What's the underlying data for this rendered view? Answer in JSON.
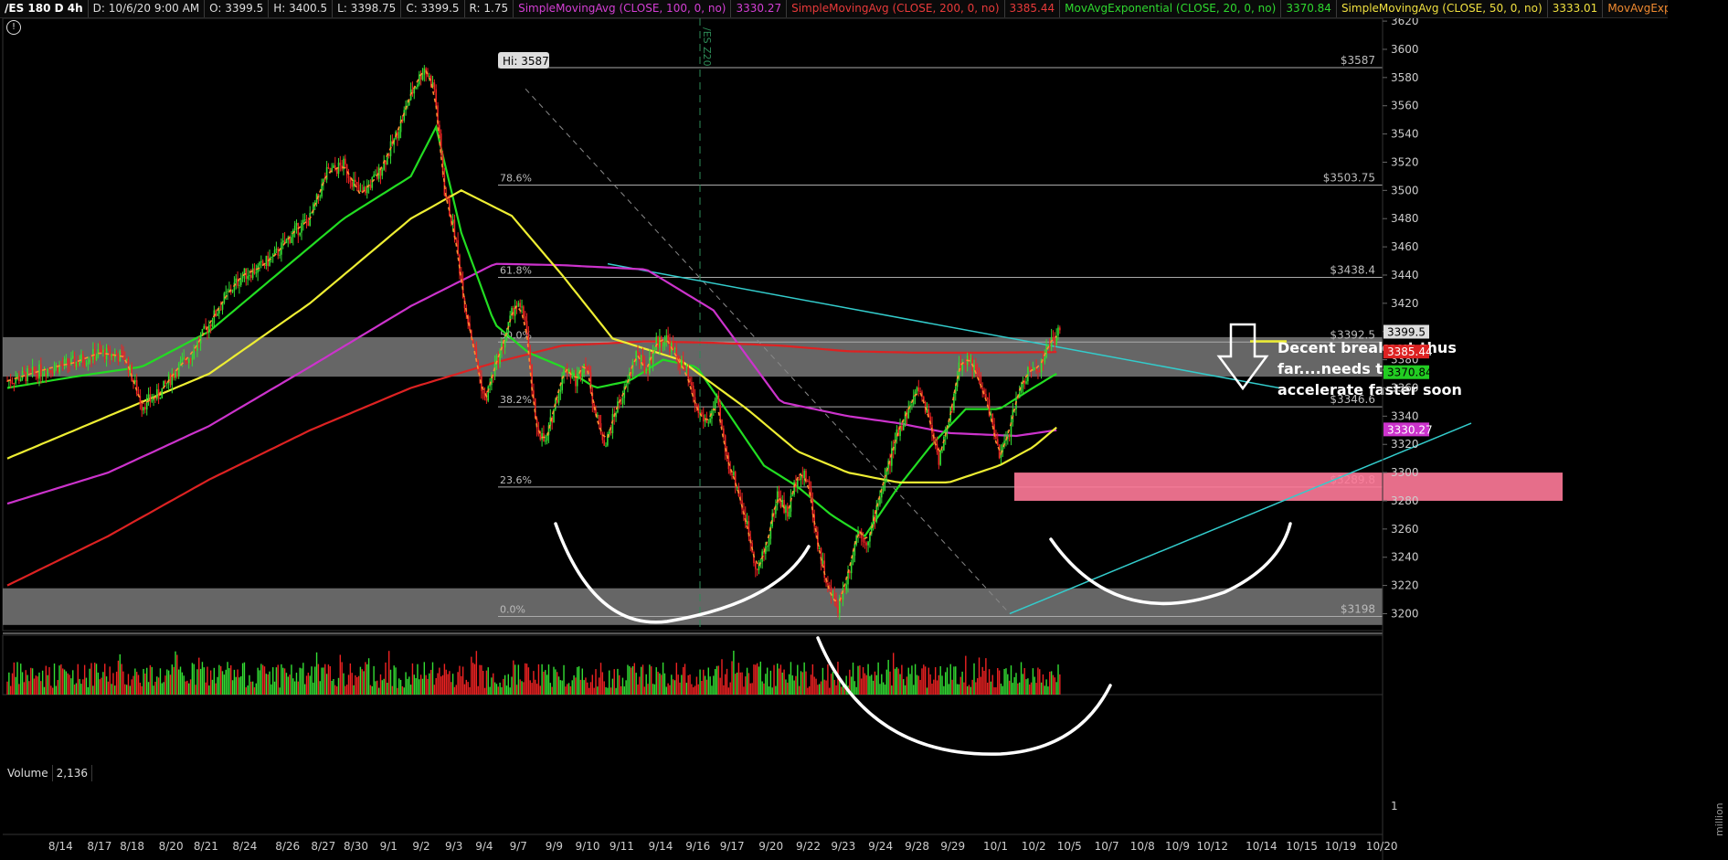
{
  "header": {
    "symbol": "/ES 180 D 4h",
    "items": [
      {
        "text": "D: 10/6/20 9:00 AM",
        "color": "#dddddd"
      },
      {
        "text": "O: 3399.5",
        "color": "#dddddd"
      },
      {
        "text": "H: 3400.5",
        "color": "#dddddd"
      },
      {
        "text": "L: 3398.75",
        "color": "#dddddd"
      },
      {
        "text": "C: 3399.5",
        "color": "#dddddd"
      },
      {
        "text": "R: 1.75",
        "color": "#dddddd"
      },
      {
        "text": "SimpleMovingAvg (CLOSE, 100, 0, no)",
        "color": "#d43fd4"
      },
      {
        "text": "3330.27",
        "color": "#d43fd4"
      },
      {
        "text": "SimpleMovingAvg (CLOSE, 200, 0, no)",
        "color": "#e83a3a"
      },
      {
        "text": "3385.44",
        "color": "#e83a3a"
      },
      {
        "text": "MovAvgExponential (CLOSE, 20, 0, no)",
        "color": "#2fd82f"
      },
      {
        "text": "3370.84",
        "color": "#2fd82f"
      },
      {
        "text": "SimpleMovingAvg (CLOSE, 50, 0, no)",
        "color": "#f0e040"
      },
      {
        "text": "3333.01",
        "color": "#f0e040"
      },
      {
        "text": "MovAvgExponential (CLOSE...",
        "color": "#f08a30"
      }
    ]
  },
  "volume_panel": {
    "label": "Volume",
    "value": "2,136",
    "ticks": [
      "1"
    ],
    "unit_label": "million"
  },
  "annotation": {
    "lines": [
      "Decent breakout thus",
      "far....needs to",
      "accelerate faster soon"
    ],
    "hi_label": "Hi: 3587",
    "vline_label": "/ES Z20"
  },
  "colors": {
    "up": "#33dd33",
    "down": "#ee2222",
    "sma100": "#cc33cc",
    "sma200": "#dd2222",
    "ema20": "#22dd22",
    "sma50": "#eeee33",
    "ema_fast": "#ff8c30",
    "zone_gray": "#888888",
    "zone_pink": "#ff7a99",
    "trendline": "#33cccc"
  },
  "chart_data": {
    "type": "candlestick",
    "ylim": [
      3188,
      3622
    ],
    "y_ticks": [
      3200,
      3220,
      3240,
      3260,
      3280,
      3300,
      3320,
      3340,
      3360,
      3380,
      3400,
      3420,
      3440,
      3460,
      3480,
      3500,
      3520,
      3540,
      3560,
      3580,
      3600,
      3620
    ],
    "x_ticks": [
      "8/14",
      "8/17",
      "8/18",
      "8/20",
      "8/21",
      "8/24",
      "8/26",
      "8/27",
      "8/30",
      "9/1",
      "9/2",
      "9/3",
      "9/4",
      "9/7",
      "9/9",
      "9/10",
      "9/11",
      "9/14",
      "9/16",
      "9/17",
      "9/20",
      "9/22",
      "9/23",
      "9/24",
      "9/28",
      "9/29",
      "10/1",
      "10/2",
      "10/5",
      "10/7",
      "10/8",
      "10/9",
      "10/12",
      "10/14",
      "10/15",
      "10/19",
      "10/20"
    ],
    "price_path": [
      [
        0,
        3365
      ],
      [
        25,
        3374
      ],
      [
        40,
        3378
      ],
      [
        55,
        3385
      ],
      [
        70,
        3382
      ],
      [
        80,
        3348
      ],
      [
        90,
        3355
      ],
      [
        100,
        3372
      ],
      [
        110,
        3385
      ],
      [
        120,
        3405
      ],
      [
        130,
        3425
      ],
      [
        140,
        3440
      ],
      [
        150,
        3445
      ],
      [
        160,
        3455
      ],
      [
        170,
        3470
      ],
      [
        180,
        3480
      ],
      [
        190,
        3512
      ],
      [
        200,
        3518
      ],
      [
        210,
        3497
      ],
      [
        220,
        3510
      ],
      [
        230,
        3535
      ],
      [
        240,
        3568
      ],
      [
        248,
        3587
      ],
      [
        254,
        3572
      ],
      [
        260,
        3500
      ],
      [
        266,
        3470
      ],
      [
        272,
        3420
      ],
      [
        278,
        3385
      ],
      [
        284,
        3350
      ],
      [
        290,
        3375
      ],
      [
        296,
        3395
      ],
      [
        302,
        3420
      ],
      [
        308,
        3410
      ],
      [
        314,
        3335
      ],
      [
        320,
        3320
      ],
      [
        326,
        3350
      ],
      [
        332,
        3375
      ],
      [
        338,
        3365
      ],
      [
        344,
        3380
      ],
      [
        350,
        3340
      ],
      [
        356,
        3320
      ],
      [
        362,
        3345
      ],
      [
        368,
        3360
      ],
      [
        374,
        3385
      ],
      [
        380,
        3372
      ],
      [
        386,
        3392
      ],
      [
        392,
        3395
      ],
      [
        398,
        3382
      ],
      [
        404,
        3370
      ],
      [
        410,
        3345
      ],
      [
        416,
        3335
      ],
      [
        422,
        3350
      ],
      [
        428,
        3310
      ],
      [
        434,
        3290
      ],
      [
        440,
        3262
      ],
      [
        446,
        3230
      ],
      [
        452,
        3250
      ],
      [
        458,
        3285
      ],
      [
        464,
        3270
      ],
      [
        470,
        3300
      ],
      [
        476,
        3295
      ],
      [
        482,
        3250
      ],
      [
        488,
        3218
      ],
      [
        494,
        3205
      ],
      [
        500,
        3228
      ],
      [
        506,
        3260
      ],
      [
        512,
        3250
      ],
      [
        518,
        3280
      ],
      [
        524,
        3305
      ],
      [
        530,
        3330
      ],
      [
        536,
        3345
      ],
      [
        542,
        3360
      ],
      [
        548,
        3340
      ],
      [
        554,
        3310
      ],
      [
        560,
        3335
      ],
      [
        566,
        3375
      ],
      [
        572,
        3382
      ],
      [
        578,
        3365
      ],
      [
        584,
        3345
      ],
      [
        590,
        3310
      ],
      [
        596,
        3330
      ],
      [
        602,
        3360
      ],
      [
        608,
        3372
      ],
      [
        614,
        3375
      ],
      [
        620,
        3392
      ],
      [
        626,
        3399
      ]
    ],
    "series": [
      {
        "name": "SimpleMovingAvg (CLOSE, 100, 0, no)",
        "key": "sma100",
        "last": 3330.27,
        "x": [
          0,
          60,
          120,
          180,
          240,
          290,
          330,
          380,
          420,
          460,
          500,
          530,
          560,
          600,
          625
        ],
        "y": [
          3278,
          3300,
          3333,
          3375,
          3418,
          3448,
          3447,
          3444,
          3415,
          3350,
          3340,
          3335,
          3328,
          3326,
          3330.27
        ]
      },
      {
        "name": "SimpleMovingAvg (CLOSE, 200, 0, no)",
        "key": "sma200",
        "last": 3385.44,
        "x": [
          0,
          60,
          120,
          180,
          240,
          290,
          330,
          380,
          420,
          460,
          500,
          540,
          580,
          625
        ],
        "y": [
          3220,
          3255,
          3295,
          3330,
          3360,
          3378,
          3390,
          3393,
          3392,
          3390,
          3386,
          3385,
          3385,
          3385.44
        ]
      },
      {
        "name": "MovAvgExponential (CLOSE, 20, 0, no)",
        "key": "ema20",
        "last": 3370.84,
        "x": [
          0,
          40,
          80,
          120,
          160,
          200,
          240,
          255,
          270,
          290,
          310,
          330,
          350,
          370,
          390,
          410,
          430,
          450,
          470,
          490,
          510,
          530,
          550,
          570,
          590,
          610,
          625
        ],
        "y": [
          3360,
          3368,
          3375,
          3400,
          3440,
          3480,
          3510,
          3545,
          3470,
          3405,
          3385,
          3375,
          3360,
          3365,
          3380,
          3375,
          3340,
          3305,
          3290,
          3270,
          3255,
          3290,
          3320,
          3345,
          3345,
          3360,
          3370.84
        ]
      },
      {
        "name": "SimpleMovingAvg (CLOSE, 50, 0, no)",
        "key": "sma50",
        "last": 3333.01,
        "x": [
          0,
          60,
          120,
          180,
          240,
          270,
          300,
          330,
          360,
          400,
          440,
          470,
          500,
          530,
          560,
          590,
          610,
          625
        ],
        "y": [
          3310,
          3340,
          3370,
          3420,
          3480,
          3500,
          3482,
          3440,
          3395,
          3380,
          3345,
          3315,
          3300,
          3293,
          3293,
          3305,
          3318,
          3333.01
        ]
      }
    ],
    "h_levels": [
      {
        "value": 3587,
        "label": "$3587",
        "fib": ""
      },
      {
        "value": 3503.75,
        "label": "$3503.75",
        "fib": "78.6%"
      },
      {
        "value": 3438.4,
        "label": "$3438.4",
        "fib": "61.8%"
      },
      {
        "value": 3392.5,
        "label": "$3392.5",
        "fib": "50.0%"
      },
      {
        "value": 3346.6,
        "label": "$3346.6",
        "fib": "38.2%"
      },
      {
        "value": 3289.8,
        "label": "$3289.8",
        "fib": "23.6%"
      },
      {
        "value": 3198,
        "label": "$3198",
        "fib": "0.0%"
      }
    ],
    "gray_zones": [
      [
        3368,
        3396
      ],
      [
        3192,
        3218
      ]
    ],
    "pink_zone": [
      3280,
      3300
    ],
    "price_tags": [
      {
        "value": 3399.5,
        "text": "3399.5",
        "bg": "#dddddd",
        "fg": "#000000"
      },
      {
        "value": 3385.44,
        "text": "3385.44",
        "bg": "#dd2222",
        "fg": "#ffffff"
      },
      {
        "value": 3370.84,
        "text": "3370.84",
        "bg": "#22cc22",
        "fg": "#000000"
      },
      {
        "value": 3330.27,
        "text": "3330.27",
        "bg": "#cc33cc",
        "fg": "#ffffff"
      }
    ]
  }
}
